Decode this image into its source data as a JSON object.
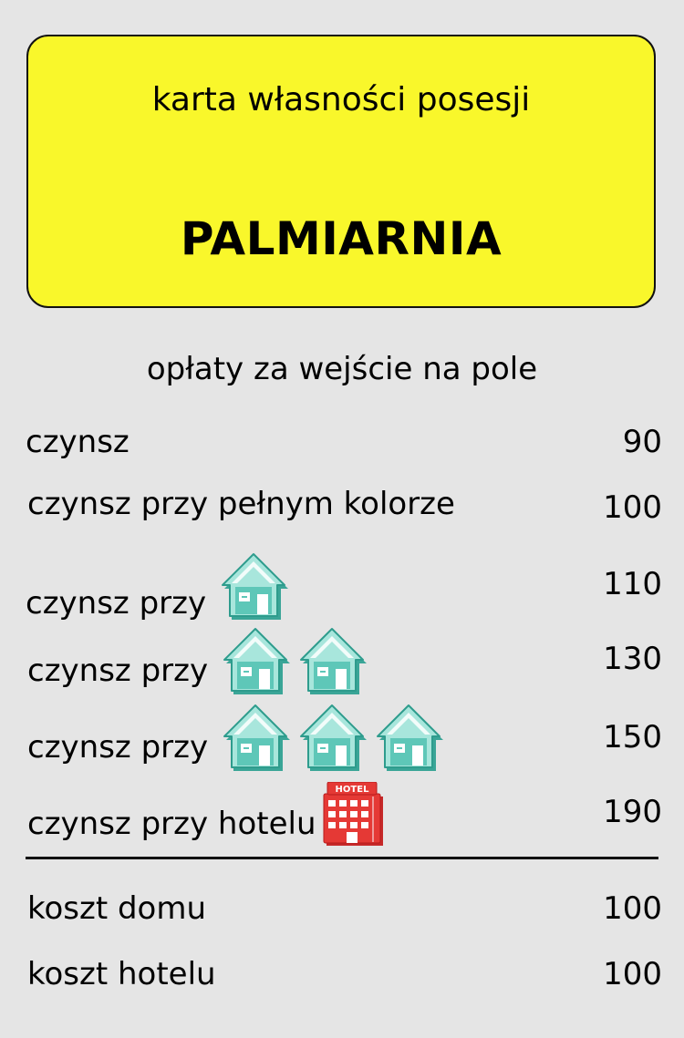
{
  "card": {
    "subtitle": "karta własności posesji",
    "title": "PALMIARNIA",
    "header_color": "#f9f72b"
  },
  "fees": {
    "heading": "opłaty za wejście na pole",
    "rows": [
      {
        "label": "czynsz",
        "value": "90",
        "houses": 0,
        "hotel": false
      },
      {
        "label": "czynsz przy pełnym kolorze",
        "value": "100",
        "houses": 0,
        "hotel": false
      },
      {
        "label": "czynsz przy",
        "value": "110",
        "houses": 1,
        "hotel": false
      },
      {
        "label": "czynsz przy",
        "value": "130",
        "houses": 2,
        "hotel": false
      },
      {
        "label": "czynsz przy",
        "value": "150",
        "houses": 3,
        "hotel": false
      },
      {
        "label": "czynsz przy hotelu",
        "value": "190",
        "houses": 0,
        "hotel": true
      }
    ]
  },
  "costs": {
    "house_label": "koszt domu",
    "house_value": "100",
    "hotel_label": "koszt hotelu",
    "hotel_value": "100"
  },
  "icons": {
    "house": "house-icon",
    "hotel": "hotel-icon",
    "hotel_sign": "HOTEL",
    "house_color": "#5ec7b8",
    "hotel_color": "#e53935"
  }
}
